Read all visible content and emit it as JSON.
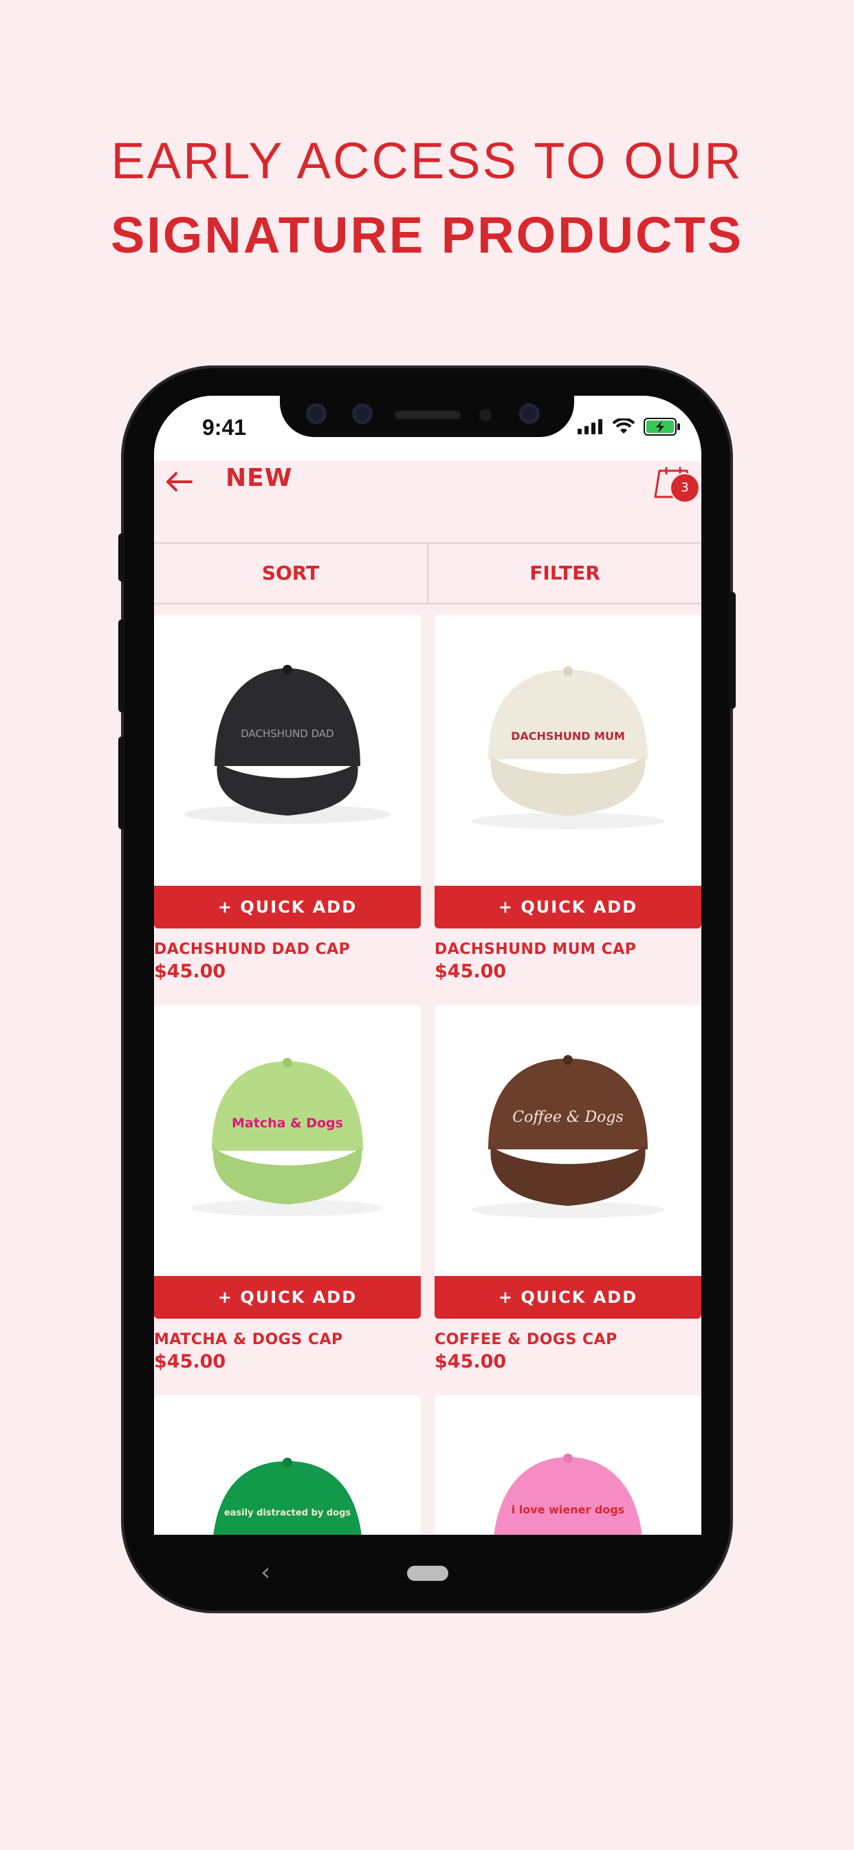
{
  "headline": {
    "line1": "EARLY ACCESS TO OUR",
    "line2": "SIGNATURE PRODUCTS"
  },
  "statusbar": {
    "time": "9:41"
  },
  "appbar": {
    "title": "NEW",
    "cart_count": "3",
    "back_icon": "arrow-left-icon",
    "cart_icon": "shopping-bag-icon"
  },
  "tabs": {
    "sort": "SORT",
    "filter": "FILTER"
  },
  "products": [
    {
      "name": "DACHSHUND DAD CAP",
      "price": "$45.00",
      "quick_add": "+ QUICK ADD",
      "cap_color": "#2b2b2d",
      "cap_text": "DACHSHUND DAD",
      "text_color": "#9a9a9a"
    },
    {
      "name": "DACHSHUND MUM CAP",
      "price": "$45.00",
      "quick_add": "+ QUICK ADD",
      "cap_color": "#ede9dc",
      "cap_text": "DACHSHUND MUM",
      "text_color": "#b8283a"
    },
    {
      "name": "MATCHA & DOGS CAP",
      "price": "$45.00",
      "quick_add": "+ QUICK ADD",
      "cap_color": "#b6db87",
      "cap_text": "Matcha & Dogs",
      "text_color": "#e0177a"
    },
    {
      "name": "COFFEE & DOGS CAP",
      "price": "$45.00",
      "quick_add": "+ QUICK ADD",
      "cap_color": "#6b3f2b",
      "cap_text": "Coffee & Dogs",
      "text_color": "#f3e6d8"
    },
    {
      "cap_color": "#12994a",
      "cap_text": "easily distracted by dogs",
      "text_color": "#f3ead0"
    },
    {
      "cap_color": "#f68cc4",
      "cap_text": "i love wiener dogs",
      "text_color": "#d7282e"
    }
  ],
  "colors": {
    "brand_red": "#d7282e",
    "background": "#fcedf0"
  }
}
